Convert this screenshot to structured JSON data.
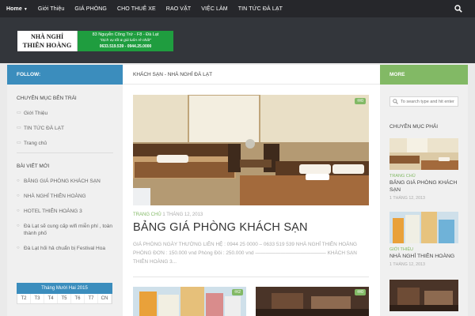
{
  "nav": {
    "items": [
      "Home",
      "Giới Thiệu",
      "GIÁ PHÒNG",
      "CHO THUÊ XE",
      "RAO VẶT",
      "VIỆC LÀM",
      "TIN TỨC ĐÀ LẠT"
    ]
  },
  "logo": {
    "line1": "NHÀ NGHỈ",
    "line2": "THIÊN HOÀNG",
    "address": "83 Nguyễn Công Trứ - F8 - Đà Lạt",
    "slogan": "\"Dịch vụ tốt & giá luôn rẻ nhất\"",
    "phones": "0633.519.539 - 0944.25.0000"
  },
  "left": {
    "bar_label": "FOLLOW:",
    "widget1_title": "CHUYÊN MỤC BÊN TRÁI",
    "widget1_items": [
      "Giới Thiệu",
      "TIN TỨC ĐÀ LẠT",
      "Trang chủ"
    ],
    "widget2_title": "BÀI VIẾT MỚI",
    "widget2_items": [
      "BẢNG GIÁ PHÒNG KHÁCH SẠN",
      "NHÀ NGHỈ THIÊN HOÀNG",
      "HOTEL THIÊN HOÀNG 3",
      "Đà Lạt sẽ cung cấp wifi miễn phí , toàn thành phố",
      "Đà Lạt hối hả chuẩn bị Festival Hoa"
    ],
    "calendar_month": "Tháng Mười Hai 2015",
    "calendar_days": [
      "T2",
      "T3",
      "T4",
      "T5",
      "T6",
      "T7",
      "CN"
    ]
  },
  "main": {
    "page_heading": "KHÁCH SẠN - NHÀ NGHỈ ĐÀ LẠT",
    "comment_count": "0",
    "category": "TRANG CHỦ",
    "date": "1 THÁNG 12, 2013",
    "title": "BẢNG GIÁ PHÒNG KHÁCH SẠN",
    "excerpt": "GIÁ PHÒNG NGÀY THƯỜNG LIÊN HỆ : 0944 25 0000 – 0633 519 539 NHÀ NGHỈ THIÊN HOÀNG PHÒNG ĐƠN : 150.000 vnd Phòng Đôi : 250.000 vnd —————————————— KHÁCH SẠN THIÊN HOÀNG 3...",
    "thumb_a_count": "2",
    "thumb_b_count": "0"
  },
  "right": {
    "bar_label": "MORE",
    "search_placeholder": "To search type and hit enter",
    "widget_title": "CHUYÊN MỤC PHẢI",
    "posts": [
      {
        "category": "TRANG CHỦ",
        "title": "BẢNG GIÁ PHÒNG KHÁCH SẠN",
        "date": "1 THÁNG 12, 2013"
      },
      {
        "category": "GIỚI THIỆU",
        "title": "NHÀ NGHỈ THIÊN HOÀNG",
        "date": "1 THÁNG 12, 2013"
      }
    ]
  },
  "colors": {
    "nav_bg": "#26272b",
    "header_bg": "#33363b",
    "accent_blue": "#3b8dbd",
    "accent_green": "#82b965"
  }
}
